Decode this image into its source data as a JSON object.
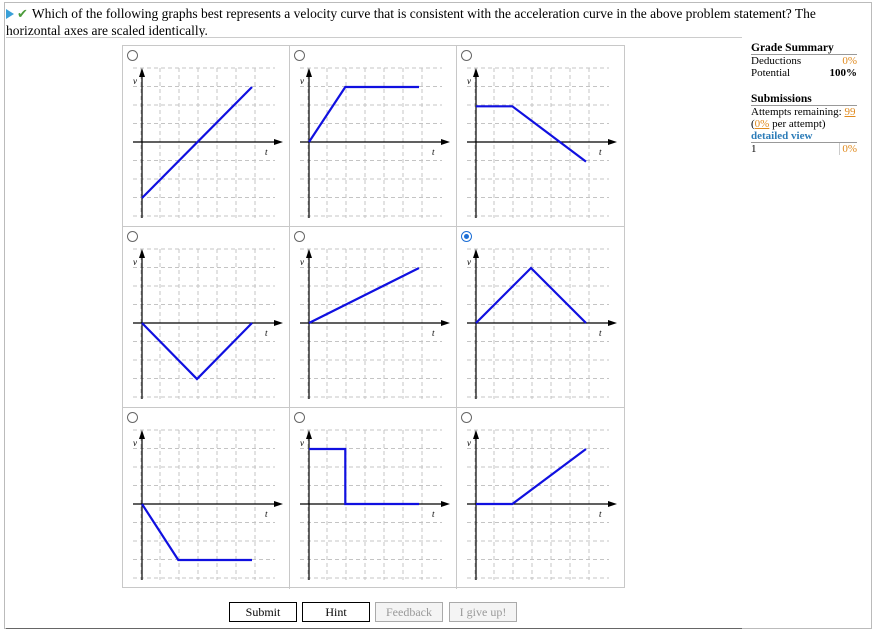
{
  "question": {
    "text": "Which of the following graphs best represents a velocity curve that is consistent with the acceleration curve in the above problem statement? The horizontal axes are scaled identically."
  },
  "plot_labels": {
    "v": "v",
    "t": "t"
  },
  "options": [
    {
      "id": "A",
      "selected": false,
      "path": [
        [
          0,
          -1
        ],
        [
          1,
          1
        ]
      ]
    },
    {
      "id": "B",
      "selected": false,
      "path": [
        [
          0,
          0
        ],
        [
          0.33,
          1
        ],
        [
          1,
          1
        ]
      ]
    },
    {
      "id": "C",
      "selected": false,
      "path": [
        [
          0,
          0.65
        ],
        [
          0.33,
          0.65
        ],
        [
          1,
          -0.35
        ]
      ]
    },
    {
      "id": "D",
      "selected": false,
      "path": [
        [
          0,
          0
        ],
        [
          0.5,
          -1
        ],
        [
          1,
          0
        ]
      ]
    },
    {
      "id": "E",
      "selected": false,
      "path": [
        [
          0,
          0
        ],
        [
          1,
          1
        ]
      ]
    },
    {
      "id": "F",
      "selected": true,
      "path": [
        [
          0,
          0
        ],
        [
          0.5,
          1
        ],
        [
          1,
          0
        ]
      ]
    },
    {
      "id": "G",
      "selected": false,
      "path": [
        [
          0,
          0
        ],
        [
          0.33,
          -1
        ],
        [
          1,
          -1
        ]
      ]
    },
    {
      "id": "H",
      "selected": false,
      "path": [
        [
          0,
          1
        ],
        [
          0.33,
          1
        ],
        [
          0.33,
          0
        ],
        [
          1,
          0
        ]
      ]
    },
    {
      "id": "I",
      "selected": false,
      "path": [
        [
          0,
          0
        ],
        [
          0.33,
          0
        ],
        [
          1,
          1
        ]
      ]
    }
  ],
  "summary": {
    "title": "Grade Summary",
    "deductions_label": "Deductions",
    "deductions_value": "0%",
    "potential_label": "Potential",
    "potential_value": "100%",
    "submissions_title": "Submissions",
    "attempts_label": "Attempts remaining:",
    "attempts_value": "99",
    "per_attempt_open": "(",
    "per_attempt_value": "0%",
    "per_attempt_rest": " per attempt)",
    "detailed_view": "detailed view",
    "submission_num": "1",
    "submission_value": "0%"
  },
  "buttons": {
    "submit": "Submit",
    "hint": "Hint",
    "feedback": "Feedback",
    "give_up": "I give up!"
  },
  "colors": {
    "curve": "#1010e0",
    "accent": "#e08a1e",
    "link": "#2c7cb8"
  }
}
